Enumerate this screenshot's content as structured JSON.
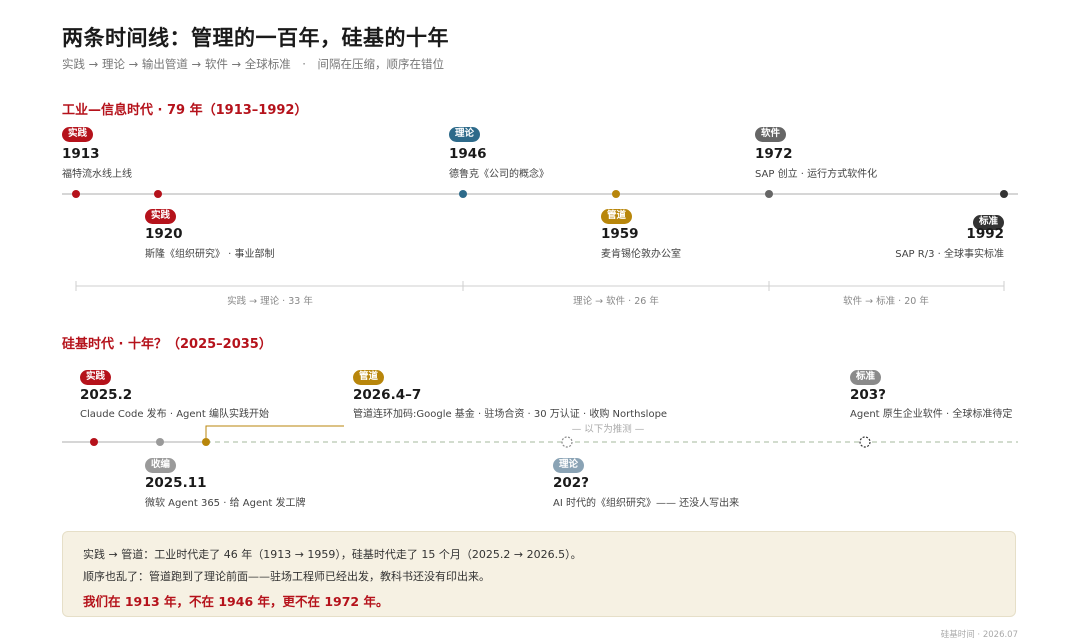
{
  "title": "两条时间线：管理的一百年，硅基的十年",
  "subtitle": "实践 → 理论 → 输出管道 → 软件 → 全球标准　·　间隔在压缩，顺序在错位",
  "colors": {
    "practice": "#b5121b",
    "theory": "#2d6a8a",
    "software": "#666666",
    "pipeline": "#b8860b",
    "standard": "#333333",
    "converge": "#9a9a9a",
    "theory_faded": "#8aa3b5",
    "standard_faded": "#8a8a8a"
  },
  "industrial": {
    "heading": "工业—信息时代 · 79 年（1913–1992）",
    "events": [
      {
        "badge": "实践",
        "year": "1913",
        "desc": "福特流水线上线"
      },
      {
        "badge": "实践",
        "year": "1920",
        "desc": "斯隆《组织研究》 · 事业部制"
      },
      {
        "badge": "理论",
        "year": "1946",
        "desc": "德鲁克《公司的概念》"
      },
      {
        "badge": "管道",
        "year": "1959",
        "desc": "麦肯锡伦敦办公室"
      },
      {
        "badge": "软件",
        "year": "1972",
        "desc": "SAP 创立 · 运行方式软件化"
      },
      {
        "badge": "标准",
        "year": "1992",
        "desc": "SAP R/3 · 全球事实标准"
      }
    ],
    "intervals": [
      "实践 → 理论 · 33 年",
      "理论 → 软件 · 26 年",
      "软件 → 标准 · 20 年"
    ]
  },
  "silicon": {
    "heading": "硅基时代 · 十年？（2025–2035）",
    "projection_label": "— 以下为推测 —",
    "events": [
      {
        "badge": "实践",
        "year": "2025.2",
        "desc": "Claude Code 发布 · Agent 编队实践开始"
      },
      {
        "badge": "收编",
        "year": "2025.11",
        "desc": "微软 Agent 365 · 给 Agent 发工牌"
      },
      {
        "badge": "管道",
        "year": "2026.4–7",
        "desc": "管道连环加码:Google 基金 · 驻场合资 · 30 万认证 · 收购 Northslope"
      },
      {
        "badge": "理论",
        "year": "202?",
        "desc": "AI 时代的《组织研究》—— 还没人写出来"
      },
      {
        "badge": "标准",
        "year": "203?",
        "desc": "Agent 原生企业软件 · 全球标准待定"
      }
    ]
  },
  "callout": {
    "line1": "实践 → 管道：工业时代走了 46 年（1913 → 1959），硅基时代走了 15 个月（2025.2 → 2026.5）。",
    "line2": "顺序也乱了：管道跑到了理论前面——驻场工程师已经出发，教科书还没有印出来。",
    "line3": "我们在 1913 年，不在 1946 年，更不在 1972 年。"
  },
  "footer": "硅基时间 · 2026.07"
}
